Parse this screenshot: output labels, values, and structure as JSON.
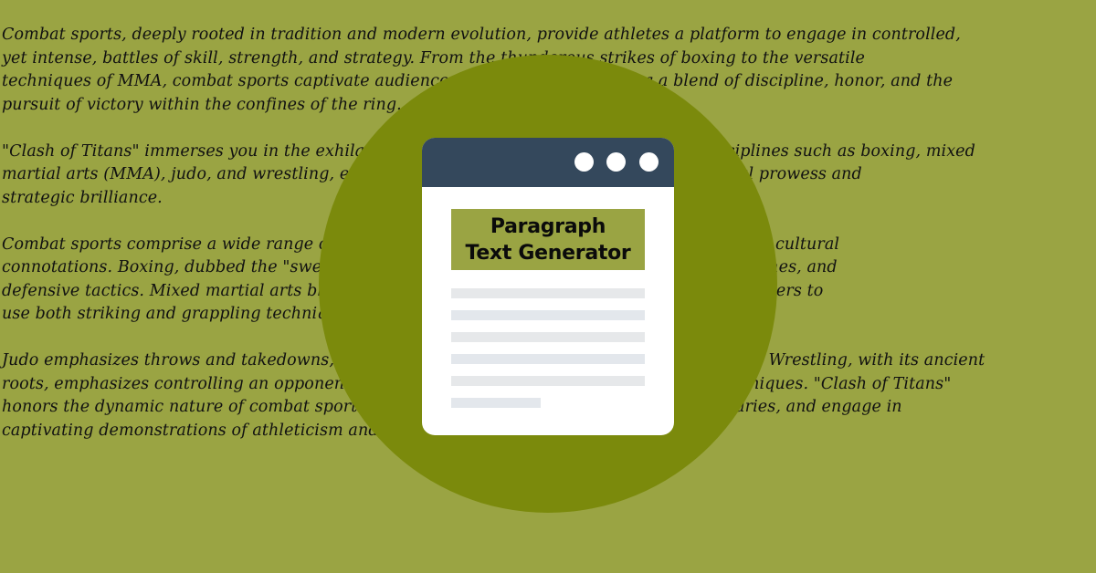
{
  "background": {
    "color": "#9aa443",
    "paragraphs": [
      {
        "lines": [
          "Combat sports, deeply rooted in tradition and modern evolution, provide athletes a platform to engage in controlled,",
          "yet intense, battles of skill, strength, and strategy. From the thunderous strikes of boxing to the versatile",
          "techniques of MMA, combat sports captivate audiences worldwide, showcasing a blend of discipline, honor, and the",
          "pursuit of victory within the confines of the ring."
        ]
      },
      {
        "lines": [
          "\"Clash of Titans\" immerses you in the exhilarating world of combat sports, exploring disciplines such as boxing, mixed",
          "martial arts (MMA), judo, and wrestling, each a testament to the heights of human physical prowess and",
          "strategic brilliance."
        ]
      },
      {
        "lines": [
          "Combat sports comprise a wide range of disciplines, each with distinct rules, techniques, and cultural",
          "connotations. Boxing, dubbed the \"sweet science,\" emphasizes precise footwork, potent punches, and",
          "defensive tactics. Mixed martial arts blends elements from various martial arts, enabling fighters to",
          "use both striking and grappling techniques."
        ]
      },
      {
        "lines": [
          "Judo emphasizes throws and takedowns, utilizing an opponent's momentum and movements. Wrestling, with its ancient",
          "roots, emphasizes controlling an opponent through grappling holds and ground-based techniques. \"Clash of Titans\"",
          "honors the dynamic nature of combat sports, where athletes test their limits, push boundaries, and engage in",
          "captivating demonstrations of athleticism and sportsmanship."
        ]
      }
    ]
  },
  "badge": {
    "circle_color": "#7b8a0c",
    "card": {
      "header_color": "#34485c",
      "window_dots": [
        "dot",
        "dot",
        "dot"
      ],
      "title_line1": "Paragraph",
      "title_line2": "Text Generator",
      "title_box_color": "#9aa443",
      "placeholder_line_count": 6
    }
  }
}
